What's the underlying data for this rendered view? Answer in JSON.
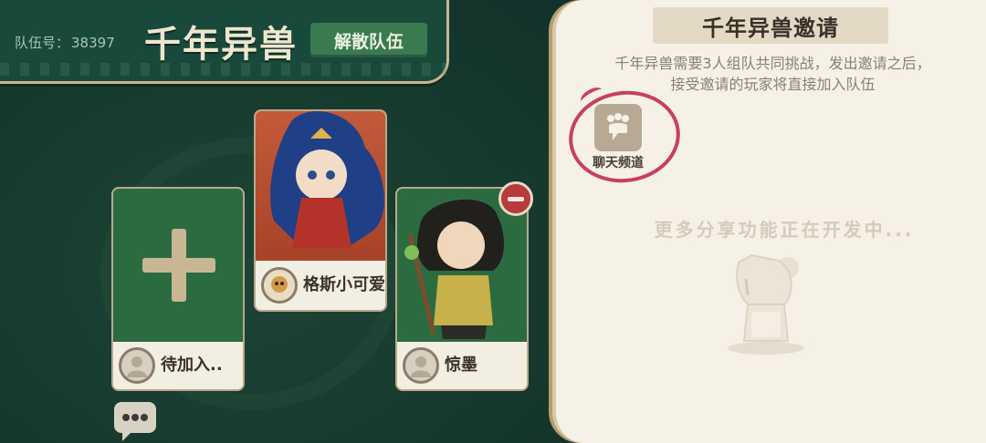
{
  "header": {
    "team_no_label": "队伍号：",
    "team_no": "38397",
    "title": "千年异兽",
    "disband_label": "解散队伍"
  },
  "members": [
    {
      "slot": "empty",
      "name": "待加入.."
    },
    {
      "slot": "leader",
      "name": "格斯小可爱"
    },
    {
      "slot": "member",
      "name": "惊墨"
    }
  ],
  "invite_panel": {
    "title": "千年异兽邀请",
    "description_line1": "千年异兽需要3人组队共同挑战，发出邀请之后，",
    "description_line2": "接受邀请的玩家将直接加入队伍",
    "chat_channel_label": "聊天频道",
    "more_features": "更多分享功能正在开发中..."
  },
  "colors": {
    "background": "#15372c",
    "header": "#19493a",
    "accent_gold": "#c9b58e",
    "disband_button": "#3a7a50",
    "panel": "#f5f1e7",
    "annotation_red": "#c9405a",
    "remove_red": "#b83b3b"
  },
  "icons": [
    "plus-icon",
    "remove-member-icon",
    "chat-bubble-icon",
    "chat-channel-icon",
    "avatar-placeholder-icon",
    "mascot-illustration"
  ]
}
